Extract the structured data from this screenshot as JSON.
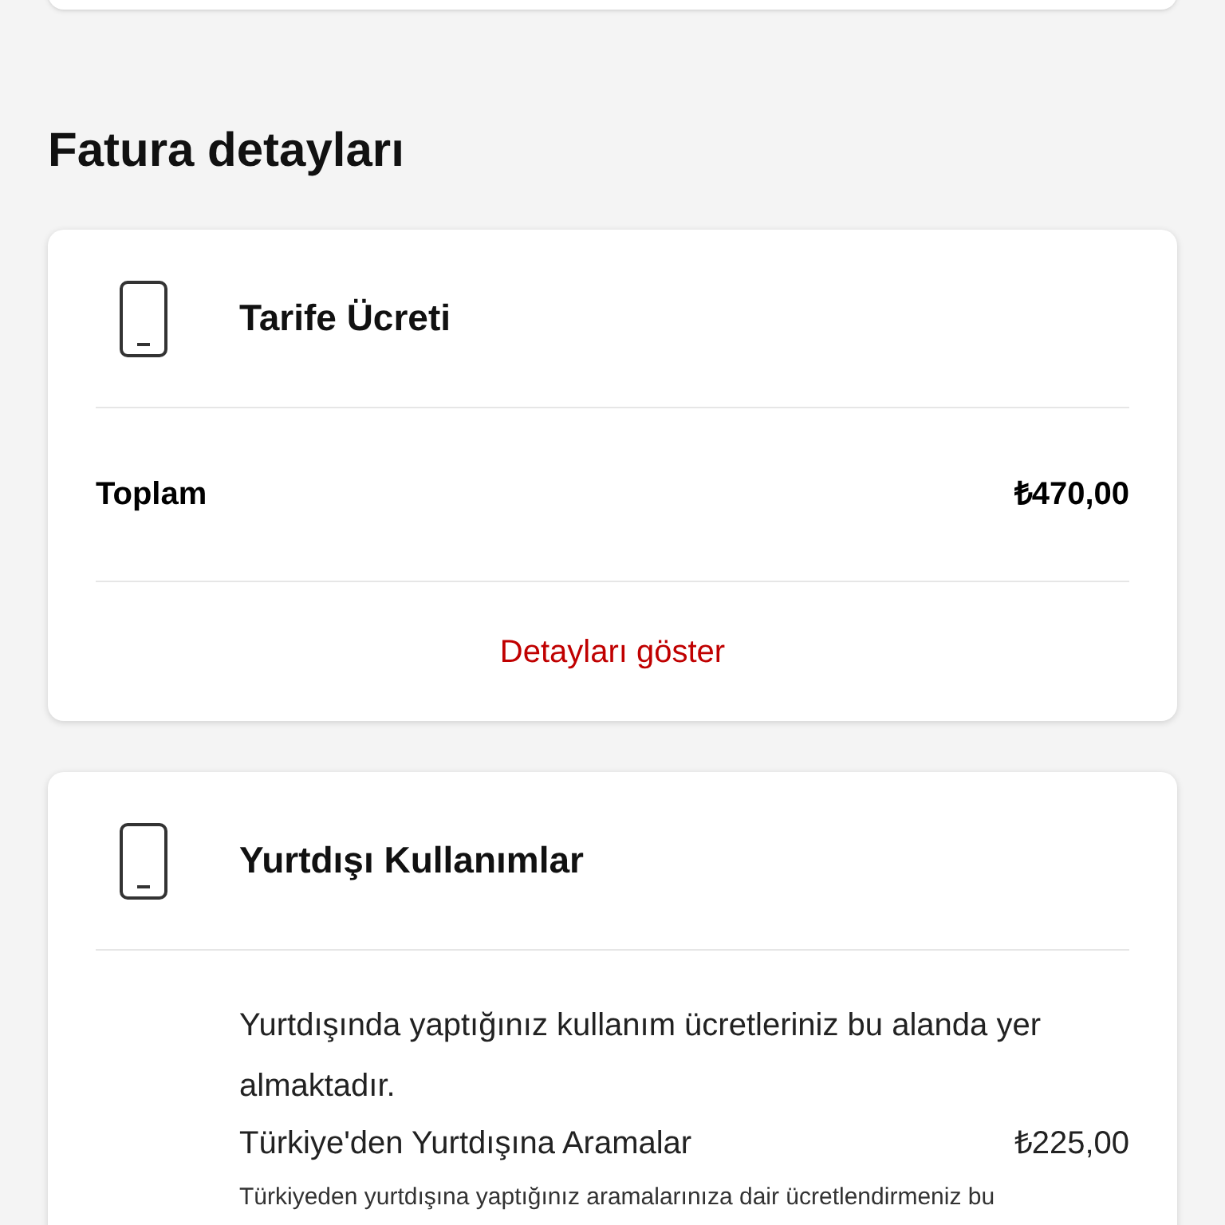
{
  "section_title": "Fatura detayları",
  "cards": [
    {
      "title": "Tarife Ücreti",
      "total_label": "Toplam",
      "total_value": "₺470,00",
      "link": "Detayları göster"
    },
    {
      "title": "Yurtdışı Kullanımlar",
      "description": "Yurtdışında yaptığınız kullanım ücretleriniz bu alanda yer almaktadır.",
      "items": [
        {
          "label": "Türkiye'den Yurtdışına Aramalar",
          "value": "₺225,00",
          "note": "Türkiyeden yurtdışına yaptığınız aramalarınıza dair ücretlendirmeniz bu"
        }
      ]
    }
  ]
}
